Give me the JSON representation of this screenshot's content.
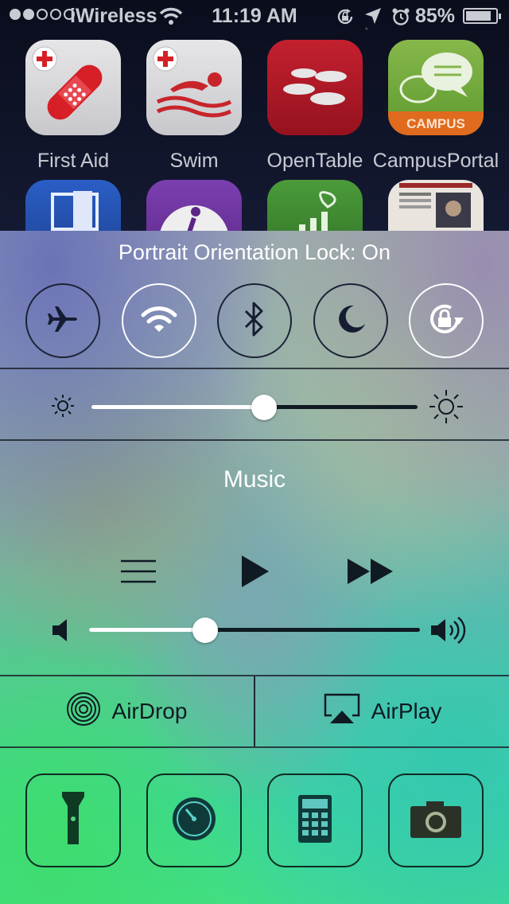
{
  "status_bar": {
    "signal_bars": 2,
    "signal_total": 5,
    "carrier": "iWireless",
    "time": "11:19 AM",
    "battery_percent": "85%",
    "battery_level": 0.85,
    "icons": [
      "orientation-lock-icon",
      "location-arrow-icon",
      "alarm-icon"
    ]
  },
  "home_apps": [
    {
      "label": "First Aid",
      "icon": "first-aid-bandage-icon"
    },
    {
      "label": "Swim",
      "icon": "swimmer-icon"
    },
    {
      "label": "OpenTable",
      "icon": "opentable-plates-icon"
    },
    {
      "label": "CampusPortal",
      "icon": "campus-chat-icon",
      "badge_text": "CAMPUS"
    },
    {
      "label": "",
      "icon": "projector-icon"
    },
    {
      "label": "",
      "icon": "walking-person-icon"
    },
    {
      "label": "",
      "icon": "gift-chart-icon"
    },
    {
      "label": "",
      "icon": "newspaper-icon"
    }
  ],
  "control_center": {
    "orientation_message": "Portrait Orientation Lock: On",
    "toggles": [
      {
        "name": "airplane-mode",
        "icon": "airplane-icon",
        "active": false
      },
      {
        "name": "wifi",
        "icon": "wifi-icon",
        "active": true
      },
      {
        "name": "bluetooth",
        "icon": "bluetooth-icon",
        "active": false
      },
      {
        "name": "do-not-disturb",
        "icon": "moon-icon",
        "active": false
      },
      {
        "name": "orientation-lock",
        "icon": "orientation-lock-icon",
        "active": true
      }
    ],
    "brightness_level": 0.53,
    "music": {
      "title": "Music",
      "controls": [
        "menu-list-icon",
        "play-icon",
        "fast-forward-icon"
      ],
      "volume_level": 0.35
    },
    "airdrop_label": "AirDrop",
    "airplay_label": "AirPlay",
    "shortcuts": [
      {
        "name": "flashlight",
        "icon": "flashlight-icon"
      },
      {
        "name": "timer",
        "icon": "timer-icon"
      },
      {
        "name": "calculator",
        "icon": "calculator-icon"
      },
      {
        "name": "camera",
        "icon": "camera-icon"
      }
    ],
    "colors": {
      "active_border": "#ffffff",
      "inactive_border": "#1c2236",
      "icon_dark": "#0f1a22",
      "slider_fill": "#ffffff"
    }
  }
}
